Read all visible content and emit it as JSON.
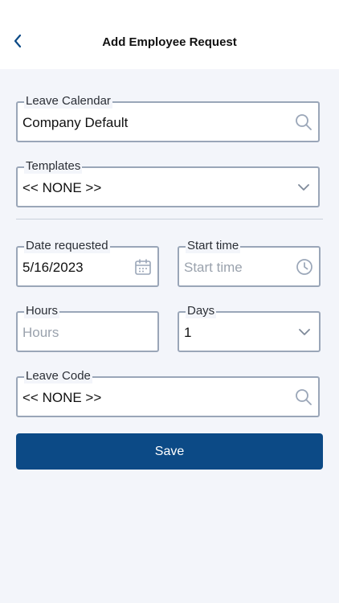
{
  "header": {
    "title": "Add Employee Request",
    "back_icon": "chevron-left-icon"
  },
  "form": {
    "leave_calendar": {
      "label": "Leave Calendar",
      "value": "Company Default",
      "icon": "search-icon"
    },
    "templates": {
      "label": "Templates",
      "value": "<< NONE >>",
      "icon": "chevron-down-icon"
    },
    "date_requested": {
      "label": "Date requested",
      "value": "5/16/2023",
      "icon": "calendar-icon"
    },
    "start_time": {
      "label": "Start time",
      "placeholder": "Start time",
      "icon": "clock-icon"
    },
    "hours": {
      "label": "Hours",
      "placeholder": "Hours"
    },
    "days": {
      "label": "Days",
      "value": "1",
      "icon": "chevron-down-icon"
    },
    "leave_code": {
      "label": "Leave Code",
      "value": "<< NONE >>",
      "icon": "search-icon"
    }
  },
  "actions": {
    "save_label": "Save"
  },
  "colors": {
    "accent": "#0c4a86",
    "border": "#9aa6b8",
    "background": "#f3f5fa"
  }
}
